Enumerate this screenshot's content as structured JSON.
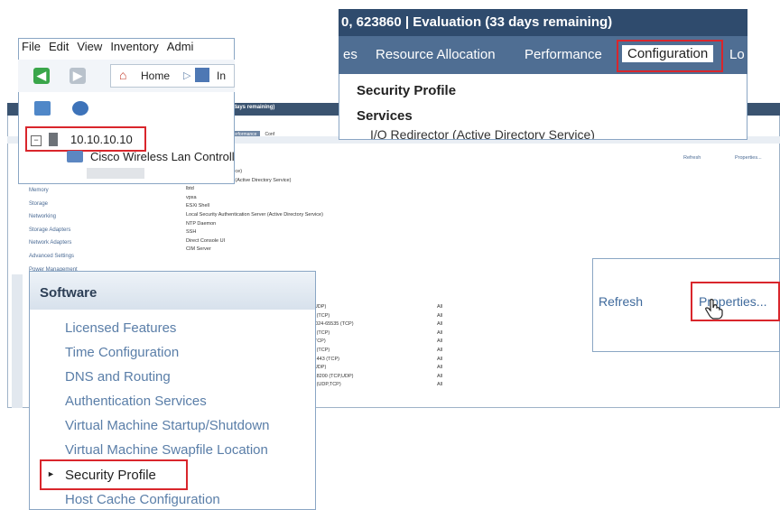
{
  "colors": {
    "highlight": "#d9262c",
    "titlebar": "#2f4b6d",
    "tabbar": "#4f6e93",
    "link": "#5a7ea8"
  },
  "background_window": {
    "title": "ation (33 days remaining)",
    "tabs": [
      "ation",
      "Performance",
      "Conf"
    ],
    "nav_items": [
      "Memory",
      "Storage",
      "Networking",
      "Storage Adapters",
      "Network Adapters",
      "Advanced Settings",
      "Power Management"
    ],
    "services": [
      "(Active Directory Service)",
      "Network Login Server (Active Directory Service)",
      "lbtd",
      "vpxa",
      "ESXi Shell",
      "Local Security Authentication Server (Active Directory Service)",
      "NTP Daemon",
      "SSH",
      "Direct Console UI",
      "CIM Server"
    ],
    "refresh": "Refresh",
    "properties": "Properties...",
    "ports": [
      "(UDP)",
      "0 (TCP)",
      "1024-65535 (TCP)",
      "9 (TCP)",
      "(TCP)",
      "2 (TCP)",
      "2,443 (TCP)",
      "(UDP)",
      "0,8200 (TCP,UDP)",
      "7 (UDP,TCP)"
    ],
    "all_label": "All"
  },
  "inventory": {
    "menu": [
      "File",
      "Edit",
      "View",
      "Inventory",
      "Admi"
    ],
    "home": "Home",
    "inv_label": "In",
    "host": "10.10.10.10",
    "child": "Cisco Wireless Lan Controll",
    "icons": {
      "back": "back-arrow-icon",
      "forward": "forward-arrow-icon",
      "home": "home-icon"
    }
  },
  "config_panel": {
    "title": "0, 623860 | Evaluation (33 days remaining)",
    "tabs": [
      "es",
      "Resource Allocation",
      "Performance",
      "Configuration",
      "Lo"
    ],
    "section1": "Security Profile",
    "section2": "Services",
    "item": "I/O Redirector (Active Directory Service)"
  },
  "refresh_panel": {
    "refresh": "Refresh",
    "properties": "Properties..."
  },
  "software": {
    "title": "Software",
    "items": [
      "Licensed Features",
      "Time Configuration",
      "DNS and Routing",
      "Authentication Services",
      "Virtual Machine Startup/Shutdown",
      "Virtual Machine Swapfile Location",
      "Security Profile",
      "Host Cache Configuration"
    ],
    "selected": "Security Profile"
  }
}
